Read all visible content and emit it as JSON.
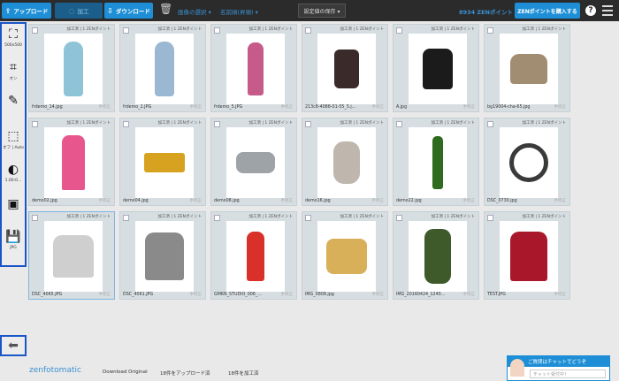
{
  "toolbar": {
    "upload": "アップロード",
    "process": "加工",
    "download": "ダウンロード",
    "select_images": "画像の選択 ▾",
    "name_sort": "名前順(昇順) ▾",
    "save_settings": "設定値の保存 ▾",
    "points": "8934 ZENポイント",
    "buy_points": "ZENポイントを購入する",
    "help": "?"
  },
  "tools": [
    {
      "name": "crop-size-tool",
      "label": "500x500"
    },
    {
      "name": "crop-tool",
      "label": "オン"
    },
    {
      "name": "brush-tool",
      "label": ""
    },
    {
      "name": "auto-tool",
      "label": "オフ | Auto"
    },
    {
      "name": "contrast-tool",
      "label": "1.00:0..."
    },
    {
      "name": "background-tool",
      "label": ""
    },
    {
      "name": "save-format-tool",
      "label": "JPG"
    }
  ],
  "cards": [
    {
      "meta": "加工済 | 1 ZENポイント",
      "file": "frdemo_14.jpg",
      "status": "手修正",
      "color": "#8fc4d8"
    },
    {
      "meta": "加工済 | 1 ZENポイント",
      "file": "frdemo_2.JPG",
      "status": "手修正",
      "color": "#9ab8d2"
    },
    {
      "meta": "加工済 | 1 ZENポイント",
      "file": "frdemo_5.JPG",
      "status": "手修正",
      "color": "#c65b8a"
    },
    {
      "meta": "加工済 | 1 ZENポイント",
      "file": "213c8-4088-01-55_5.j...",
      "status": "手修正",
      "color": "#3a2a2a"
    },
    {
      "meta": "加工済 | 1 ZENポイント",
      "file": "A.jpg",
      "status": "手修正",
      "color": "#1b1b1b"
    },
    {
      "meta": "加工済 | 1 ZENポイント",
      "file": "bg19004-cha-65.jpg",
      "status": "手修正",
      "color": "#a08d72"
    },
    {
      "meta": "加工済 | 1 ZENポイント",
      "file": "demo02.jpg",
      "status": "手修正",
      "color": "#e8568e"
    },
    {
      "meta": "加工済 | 1 ZENポイント",
      "file": "demo04.jpg",
      "status": "手修正",
      "color": "#d6a21f"
    },
    {
      "meta": "加工済 | 1 ZENポイント",
      "file": "demo08.jpg",
      "status": "手修正",
      "color": "#9ea3a8"
    },
    {
      "meta": "加工済 | 1 ZENポイント",
      "file": "demo16.jpg",
      "status": "手修正",
      "color": "#bfb7ad"
    },
    {
      "meta": "加工済 | 1 ZENポイント",
      "file": "demo22.jpg",
      "status": "手修正",
      "color": "#2f6b1e"
    },
    {
      "meta": "加工済 | 1 ZENポイント",
      "file": "DSC_0730.jpg",
      "status": "手修正",
      "color": "#3a3a3a"
    },
    {
      "meta": "加工済 | 1 ZENポイント",
      "file": "DSC_4065.JPG",
      "status": "手修正",
      "color": "#cfcfcf"
    },
    {
      "meta": "加工済 | 1 ZENポイント",
      "file": "DSC_4061.JPG",
      "status": "手修正",
      "color": "#8a8a8a"
    },
    {
      "meta": "加工済 | 1 ZENポイント",
      "file": "GMKN_STUDIO_006_...",
      "status": "手修正",
      "color": "#d9302a"
    },
    {
      "meta": "加工済 | 1 ZENポイント",
      "file": "IMG_0808.jpg",
      "status": "手修正",
      "color": "#d9b05a"
    },
    {
      "meta": "加工済 | 1 ZENポイント",
      "file": "IMG_20160424_1240...",
      "status": "手修正",
      "color": "#3e5a2a"
    },
    {
      "meta": "加工済 | 1 ZENポイント",
      "file": "TEST.JPG",
      "status": "手修正",
      "color": "#a8182a"
    }
  ],
  "footer": {
    "logo": "zenfotomatic",
    "download_original": "Download Original",
    "uploaded": "18件をアップロード済",
    "processed": "18件を加工済"
  },
  "chat": {
    "header": "ご質問はチャットでどうぞ",
    "placeholder": "チャット受付中！"
  }
}
